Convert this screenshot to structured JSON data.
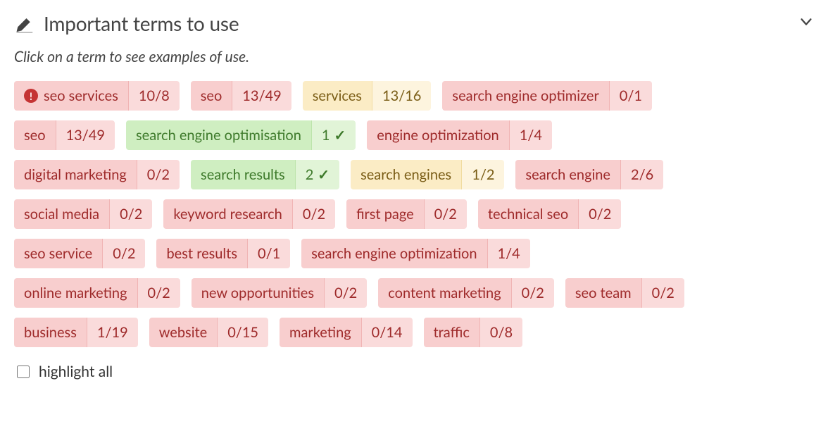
{
  "header": {
    "title": "Important terms to use"
  },
  "instruction": "Click on a term to see examples of use.",
  "rows": [
    [
      {
        "label": "seo services",
        "count": "10/8",
        "tone": "red",
        "warn": true
      },
      {
        "label": "seo",
        "count": "13/49",
        "tone": "red"
      },
      {
        "label": "services",
        "count": "13/16",
        "tone": "yellow"
      },
      {
        "label": "search engine optimizer",
        "count": "0/1",
        "tone": "red"
      }
    ],
    [
      {
        "label": "seo",
        "count": "13/49",
        "tone": "red"
      },
      {
        "label": "search engine optimisation",
        "count": "1",
        "tone": "green",
        "check": true
      },
      {
        "label": "engine optimization",
        "count": "1/4",
        "tone": "red"
      }
    ],
    [
      {
        "label": "digital marketing",
        "count": "0/2",
        "tone": "red"
      },
      {
        "label": "search results",
        "count": "2",
        "tone": "green",
        "check": true
      },
      {
        "label": "search engines",
        "count": "1/2",
        "tone": "yellow"
      },
      {
        "label": "search engine",
        "count": "2/6",
        "tone": "red"
      }
    ],
    [
      {
        "label": "social media",
        "count": "0/2",
        "tone": "red"
      },
      {
        "label": "keyword research",
        "count": "0/2",
        "tone": "red"
      },
      {
        "label": "first page",
        "count": "0/2",
        "tone": "red"
      },
      {
        "label": "technical seo",
        "count": "0/2",
        "tone": "red"
      }
    ],
    [
      {
        "label": "seo service",
        "count": "0/2",
        "tone": "red"
      },
      {
        "label": "best results",
        "count": "0/1",
        "tone": "red"
      },
      {
        "label": "search engine optimization",
        "count": "1/4",
        "tone": "red"
      }
    ],
    [
      {
        "label": "online marketing",
        "count": "0/2",
        "tone": "red"
      },
      {
        "label": "new opportunities",
        "count": "0/2",
        "tone": "red"
      },
      {
        "label": "content marketing",
        "count": "0/2",
        "tone": "red"
      },
      {
        "label": "seo team",
        "count": "0/2",
        "tone": "red"
      }
    ],
    [
      {
        "label": "business",
        "count": "1/19",
        "tone": "red"
      },
      {
        "label": "website",
        "count": "0/15",
        "tone": "red"
      },
      {
        "label": "marketing",
        "count": "0/14",
        "tone": "red"
      },
      {
        "label": "traffic",
        "count": "0/8",
        "tone": "red"
      }
    ]
  ],
  "highlight_all_label": "highlight all"
}
